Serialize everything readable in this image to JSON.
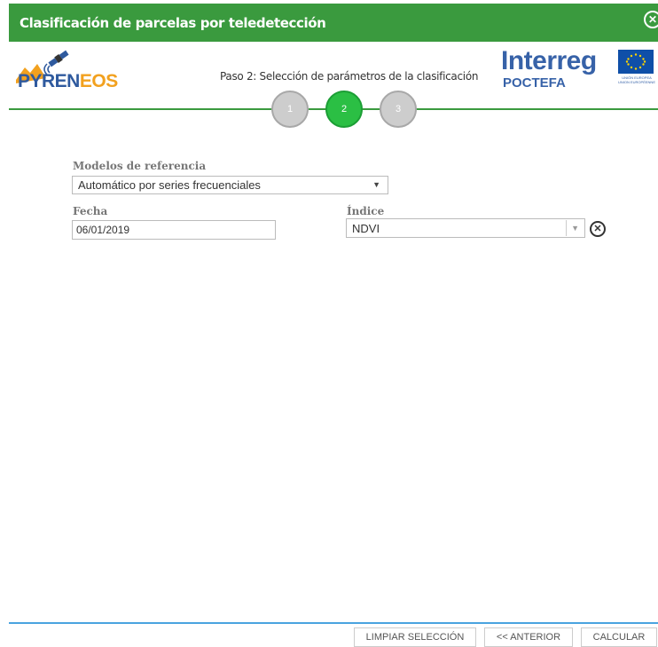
{
  "window": {
    "title": "Clasificación de parcelas por teledetección",
    "close_symbol": "✕",
    "colors": {
      "header": "#3a9a3e",
      "active_step": "#2bbf44",
      "inactive_step": "#cdcdcd",
      "footer_rule": "#4aa3df"
    }
  },
  "logos": {
    "pyreneos": {
      "part1": "PYREN",
      "part2": "EOS",
      "icon": "satellite-icon"
    },
    "interreg": {
      "brand": "Interreg",
      "sub": "POCTEFA",
      "eu_caption": "UNIÓN EUROPEA UNION EUROPÉENNE",
      "icon": "eu-flag-icon"
    }
  },
  "wizard": {
    "step_title": "Paso 2: Selección de parámetros de la clasificación",
    "steps": [
      {
        "label": "1",
        "active": false
      },
      {
        "label": "2",
        "active": true
      },
      {
        "label": "3",
        "active": false
      }
    ]
  },
  "form": {
    "modelos": {
      "label": "Modelos de referencia",
      "value": "Automático por series frecuenciales",
      "arrow": "▼"
    },
    "fecha": {
      "label": "Fecha",
      "value": "06/01/2019"
    },
    "indice": {
      "label": "Índice",
      "value": "NDVI",
      "arrow": "▼",
      "clear_symbol": "✕"
    }
  },
  "footer": {
    "buttons": {
      "clear": "LIMPIAR SELECCIÓN",
      "previous": "<< ANTERIOR",
      "calculate": "CALCULAR"
    }
  }
}
